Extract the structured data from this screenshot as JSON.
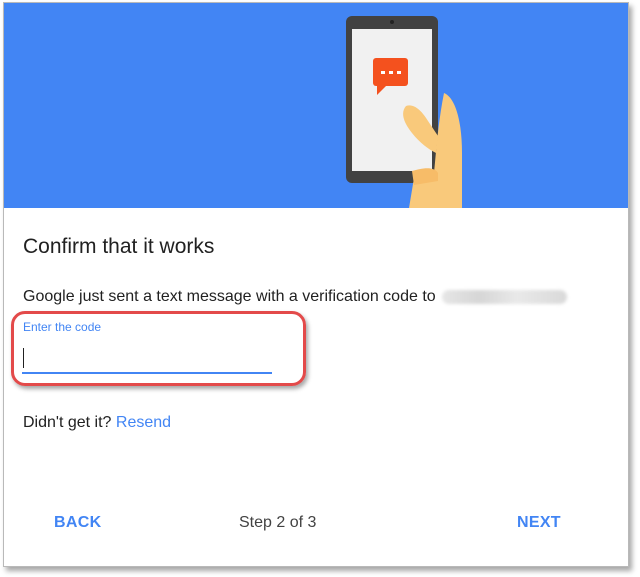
{
  "dialog": {
    "title": "Confirm that it works",
    "message": "Google just sent a text message with a verification code to",
    "code_field": {
      "label": "Enter the code",
      "value": "",
      "placeholder": ""
    },
    "resend": {
      "prompt": "Didn't get it?",
      "link": "Resend"
    },
    "footer": {
      "back_label": "BACK",
      "step_text": "Step 2 of 3",
      "next_label": "NEXT"
    }
  },
  "colors": {
    "hero_background": "#4285f4",
    "accent": "#4285f4",
    "highlight": "#e34a4a",
    "chat_bubble": "#f4511e"
  },
  "icons": [
    "phone-illustration",
    "chat-bubble-icon"
  ]
}
